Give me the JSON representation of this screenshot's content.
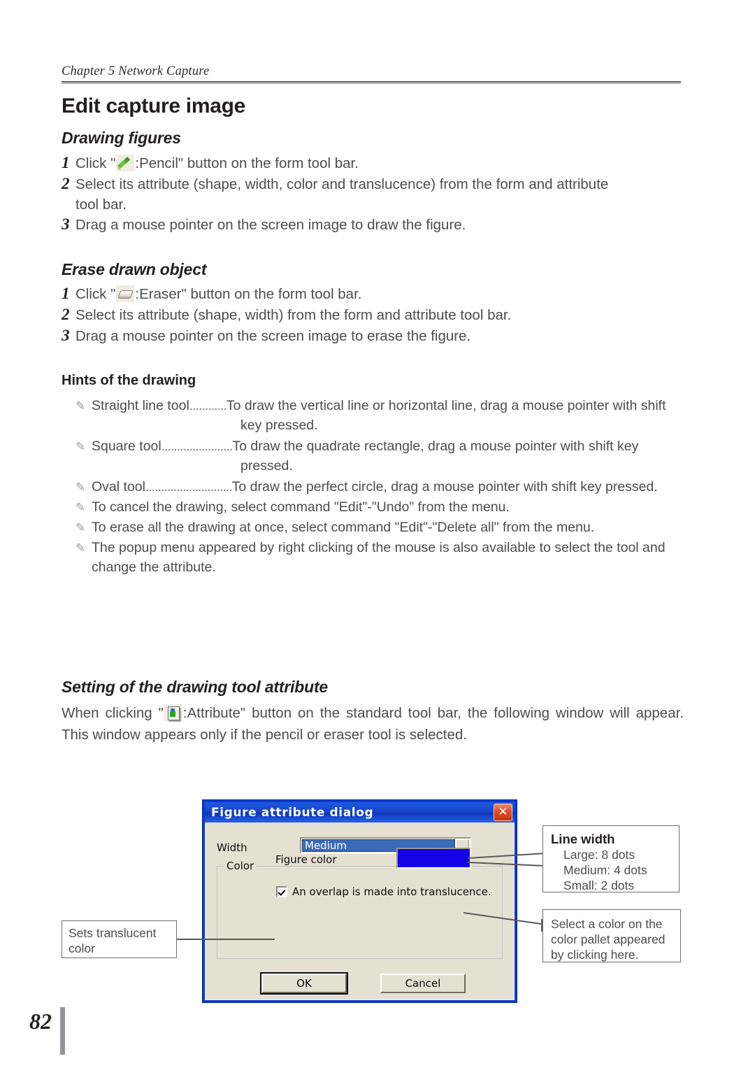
{
  "header": {
    "chapter": "Chapter 5 Network Capture"
  },
  "title": "Edit capture image",
  "sections": {
    "drawing_figures": {
      "heading": "Drawing figures",
      "steps": [
        {
          "num": "1",
          "before": "Click \"",
          "icon": "pencil-icon",
          "after": ":Pencil\" button on the form tool bar."
        },
        {
          "num": "2",
          "text": "Select its attribute (shape, width, color and translucence) from the form and attribute",
          "text2": "tool bar."
        },
        {
          "num": "3",
          "text": "Drag a mouse pointer on the screen image to draw the figure."
        }
      ]
    },
    "erase_drawn_object": {
      "heading": "Erase drawn object",
      "steps": [
        {
          "num": "1",
          "before": "Click \"",
          "icon": "eraser-icon",
          "after": ":Eraser\" button on the form tool bar."
        },
        {
          "num": "2",
          "text": "Select its attribute (shape, width) from the form and attribute tool bar."
        },
        {
          "num": "3",
          "text": "Drag a mouse pointer on the screen image to erase the figure."
        }
      ]
    },
    "hints": {
      "heading": "Hints of the drawing",
      "items": [
        {
          "label": "Straight line tool",
          "leader": "............",
          "text": "To draw the vertical line or horizontal line, drag a mouse pointer with shift",
          "cont": "key pressed."
        },
        {
          "label": "Square tool",
          "leader": ".......................",
          "text": "To draw the quadrate rectangle, drag a mouse pointer with shift key",
          "cont": "pressed."
        },
        {
          "label": "Oval tool",
          "leader": "............................",
          "text": "To draw the perfect circle, drag a mouse pointer with shift key pressed.",
          "cont": ""
        },
        {
          "label": "",
          "leader": "",
          "text": "To cancel the drawing, select command \"Edit\"-\"Undo\" from the menu.",
          "cont": ""
        },
        {
          "label": "",
          "leader": "",
          "text": "To erase all the drawing at once, select command \"Edit\"-\"Delete all\" from the menu.",
          "cont": ""
        },
        {
          "label": "",
          "leader": "",
          "text": "The popup menu appeared by right clicking of the mouse is also available to select the tool and",
          "wrap": "change the attribute."
        }
      ]
    },
    "setting_attribute": {
      "heading": "Setting of the drawing tool attribute",
      "para_before": "When clicking \"",
      "icon": "attribute-icon",
      "para_after": ":Attribute\" button on the standard tool bar, the following window will appear. This window appears only if the pencil or eraser tool is selected."
    }
  },
  "dialog": {
    "title": "Figure attribute dialog",
    "close_label": "✕",
    "width_label": "Width",
    "width_value": "Medium",
    "color_group_label": "Color",
    "figure_color_label": "Figure color",
    "figure_color_value": "#1500E8",
    "translucence_label": "An overlap is made into translucence.",
    "translucence_checked": true,
    "ok_label": "OK",
    "cancel_label": "Cancel"
  },
  "callouts": {
    "line_width": {
      "title": "Line width",
      "lines": [
        "Large: 8 dots",
        "Medium: 4 dots",
        "Small: 2 dots"
      ]
    },
    "color_pallet": {
      "lines": [
        "Select a color on the",
        "color pallet appeared",
        "by clicking here."
      ]
    },
    "translucent": {
      "lines": [
        "Sets translucent",
        "color"
      ]
    }
  },
  "footer": {
    "page_number": "82"
  }
}
